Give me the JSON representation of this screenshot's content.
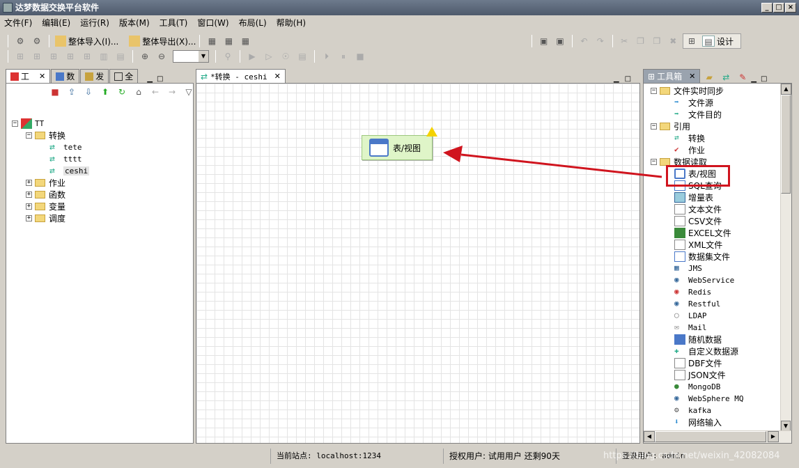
{
  "window": {
    "title": "达梦数据交换平台软件"
  },
  "menu": [
    "文件(F)",
    "编辑(E)",
    "运行(R)",
    "版本(M)",
    "工具(T)",
    "窗口(W)",
    "布局(L)",
    "帮助(H)"
  ],
  "toolbar": {
    "import_label": "整体导入(I)...",
    "export_label": "整体导出(X)...",
    "design_label": "设计"
  },
  "left_panel": {
    "tabs": [
      "工",
      "数",
      "发",
      "全"
    ],
    "tree": {
      "root": "TT",
      "transform": "转换",
      "transform_items": [
        "tete",
        "tttt",
        "ceshi"
      ],
      "others": [
        "作业",
        "函数",
        "变量",
        "调度"
      ]
    }
  },
  "editor": {
    "tab_label": "*转换 - ceshi",
    "node_label": "表/视图"
  },
  "toolbox": {
    "title": "工具箱",
    "cat_file_sync": "文件实时同步",
    "file_sync_items": [
      "文件源",
      "文件目的"
    ],
    "cat_reference": "引用",
    "reference_items": [
      "转换",
      "作业"
    ],
    "cat_data_read": "数据读取",
    "data_read_items": [
      "表/视图",
      "SQL查询",
      "增量表",
      "文本文件",
      "CSV文件",
      "EXCEL文件",
      "XML文件",
      "数据集文件",
      "JMS",
      "WebService",
      "Redis",
      "Restful",
      "LDAP",
      "Mail",
      "随机数据",
      "自定义数据源",
      "DBF文件",
      "JSON文件",
      "MongoDB",
      "WebSphere MQ",
      "kafka",
      "网络输入"
    ]
  },
  "status": {
    "site": "当前站点: localhost:1234",
    "auth": "授权用户: 试用用户 还剩90天",
    "login": "登录用户: admin",
    "watermark": "https://blog.csdn.net/weixin_42082084"
  },
  "colors": {
    "highlight_box": "#d0141e",
    "arrow": "#d0141e",
    "node_fill": "#dff5c8"
  }
}
